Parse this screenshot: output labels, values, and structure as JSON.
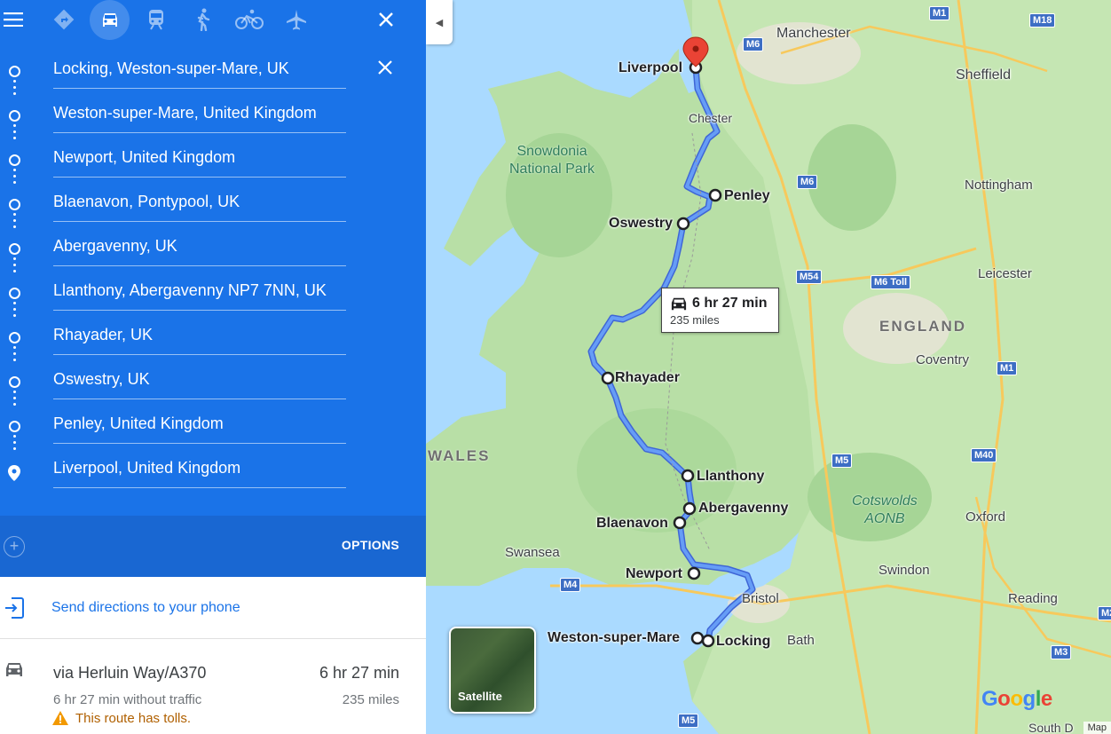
{
  "topbar": {
    "modes": [
      {
        "name": "menu-icon"
      },
      {
        "name": "best-mode-icon"
      },
      {
        "name": "driving-icon"
      },
      {
        "name": "transit-icon"
      },
      {
        "name": "walking-icon"
      },
      {
        "name": "cycling-icon"
      },
      {
        "name": "flights-icon"
      },
      {
        "name": "close-icon"
      }
    ],
    "selected_mode": "driving"
  },
  "stops": [
    "Locking, Weston-super-Mare, UK",
    "Weston-super-Mare, United Kingdom",
    "Newport, United Kingdom",
    "Blaenavon, Pontypool, UK",
    "Abergavenny, UK",
    "Llanthony, Abergavenny NP7 7NN, UK",
    "Rhayader, UK",
    "Oswestry, UK",
    "Penley, United Kingdom",
    "Liverpool, United Kingdom"
  ],
  "options_label": "OPTIONS",
  "send_directions": "Send directions to your phone",
  "route": {
    "via": "via Herluin Way/A370",
    "time": "6 hr 27 min",
    "without_traffic": "6 hr 27 min without traffic",
    "distance": "235 miles",
    "tolls_warning": "This route has tolls."
  },
  "map": {
    "callout": {
      "time": "6 hr 27 min",
      "distance": "235 miles"
    },
    "cities": [
      "Manchester",
      "Sheffield",
      "Chester",
      "Nottingham",
      "Leicester",
      "Coventry",
      "Swansea",
      "Bristol",
      "Bath",
      "Swindon",
      "Reading",
      "Oxford",
      "South D"
    ],
    "waypoints": [
      "Liverpool",
      "Penley",
      "Oswestry",
      "Rhayader",
      "Llanthony",
      "Abergavenny",
      "Blaenavon",
      "Newport",
      "Weston-super-Mare",
      "Locking"
    ],
    "regions": [
      "ENGLAND",
      "WALES"
    ],
    "parks": {
      "snowdonia": [
        "Snowdonia",
        "National Park"
      ],
      "cotswolds": [
        "Cotswolds",
        "AONB"
      ]
    },
    "roads": [
      "M1",
      "M18",
      "M6",
      "M6",
      "M54",
      "M6 Toll",
      "M1",
      "M5",
      "M40",
      "M4",
      "M3",
      "M2",
      "M5"
    ],
    "satellite_label": "Satellite",
    "google_logo": "Google",
    "map_data": "Map"
  },
  "colors": {
    "panel_blue": "#1a73e8",
    "route_line": "#4c7ef0",
    "land": "#b8dfa6",
    "water": "#aadaff",
    "warning": "#f29900"
  }
}
